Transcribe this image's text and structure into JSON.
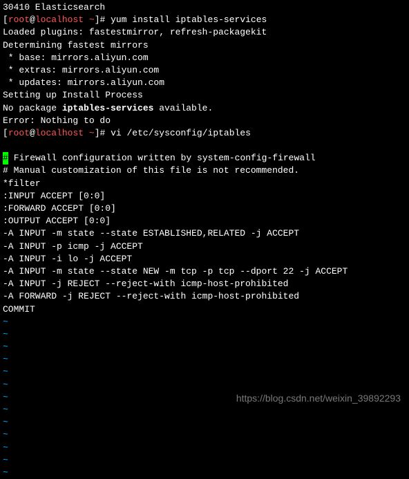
{
  "top_fragment": "30410 Elasticsearch",
  "prompt1": {
    "user": "root",
    "host": "localhost",
    "dir": "~",
    "cmd": "yum install iptables-services"
  },
  "output": {
    "line1": "Loaded plugins: fastestmirror, refresh-packagekit",
    "line2": "Determining fastest mirrors",
    "line3": " * base: mirrors.aliyun.com",
    "line4": " * extras: mirrors.aliyun.com",
    "line5": " * updates: mirrors.aliyun.com",
    "line6": "Setting up Install Process",
    "line7_pre": "No package ",
    "line7_pkg": "iptables-services",
    "line7_post": " available.",
    "line8": "Error: Nothing to do"
  },
  "prompt2": {
    "cmd": "vi /etc/sysconfig/iptables"
  },
  "vi": {
    "line1_rest": " Firewall configuration written by system-config-firewall",
    "line2": "# Manual customization of this file is not recommended.",
    "line3": "*filter",
    "line4": ":INPUT ACCEPT [0:0]",
    "line5": ":FORWARD ACCEPT [0:0]",
    "line6": ":OUTPUT ACCEPT [0:0]",
    "line7": "-A INPUT -m state --state ESTABLISHED,RELATED -j ACCEPT",
    "line8": "-A INPUT -p icmp -j ACCEPT",
    "line9": "-A INPUT -i lo -j ACCEPT",
    "line10": "-A INPUT -m state --state NEW -m tcp -p tcp --dport 22 -j ACCEPT",
    "line11": "-A INPUT -j REJECT --reject-with icmp-host-prohibited",
    "line12": "-A FORWARD -j REJECT --reject-with icmp-host-prohibited",
    "line13": "COMMIT"
  },
  "tilde": "~",
  "watermark": "https://blog.csdn.net/weixin_39892293"
}
